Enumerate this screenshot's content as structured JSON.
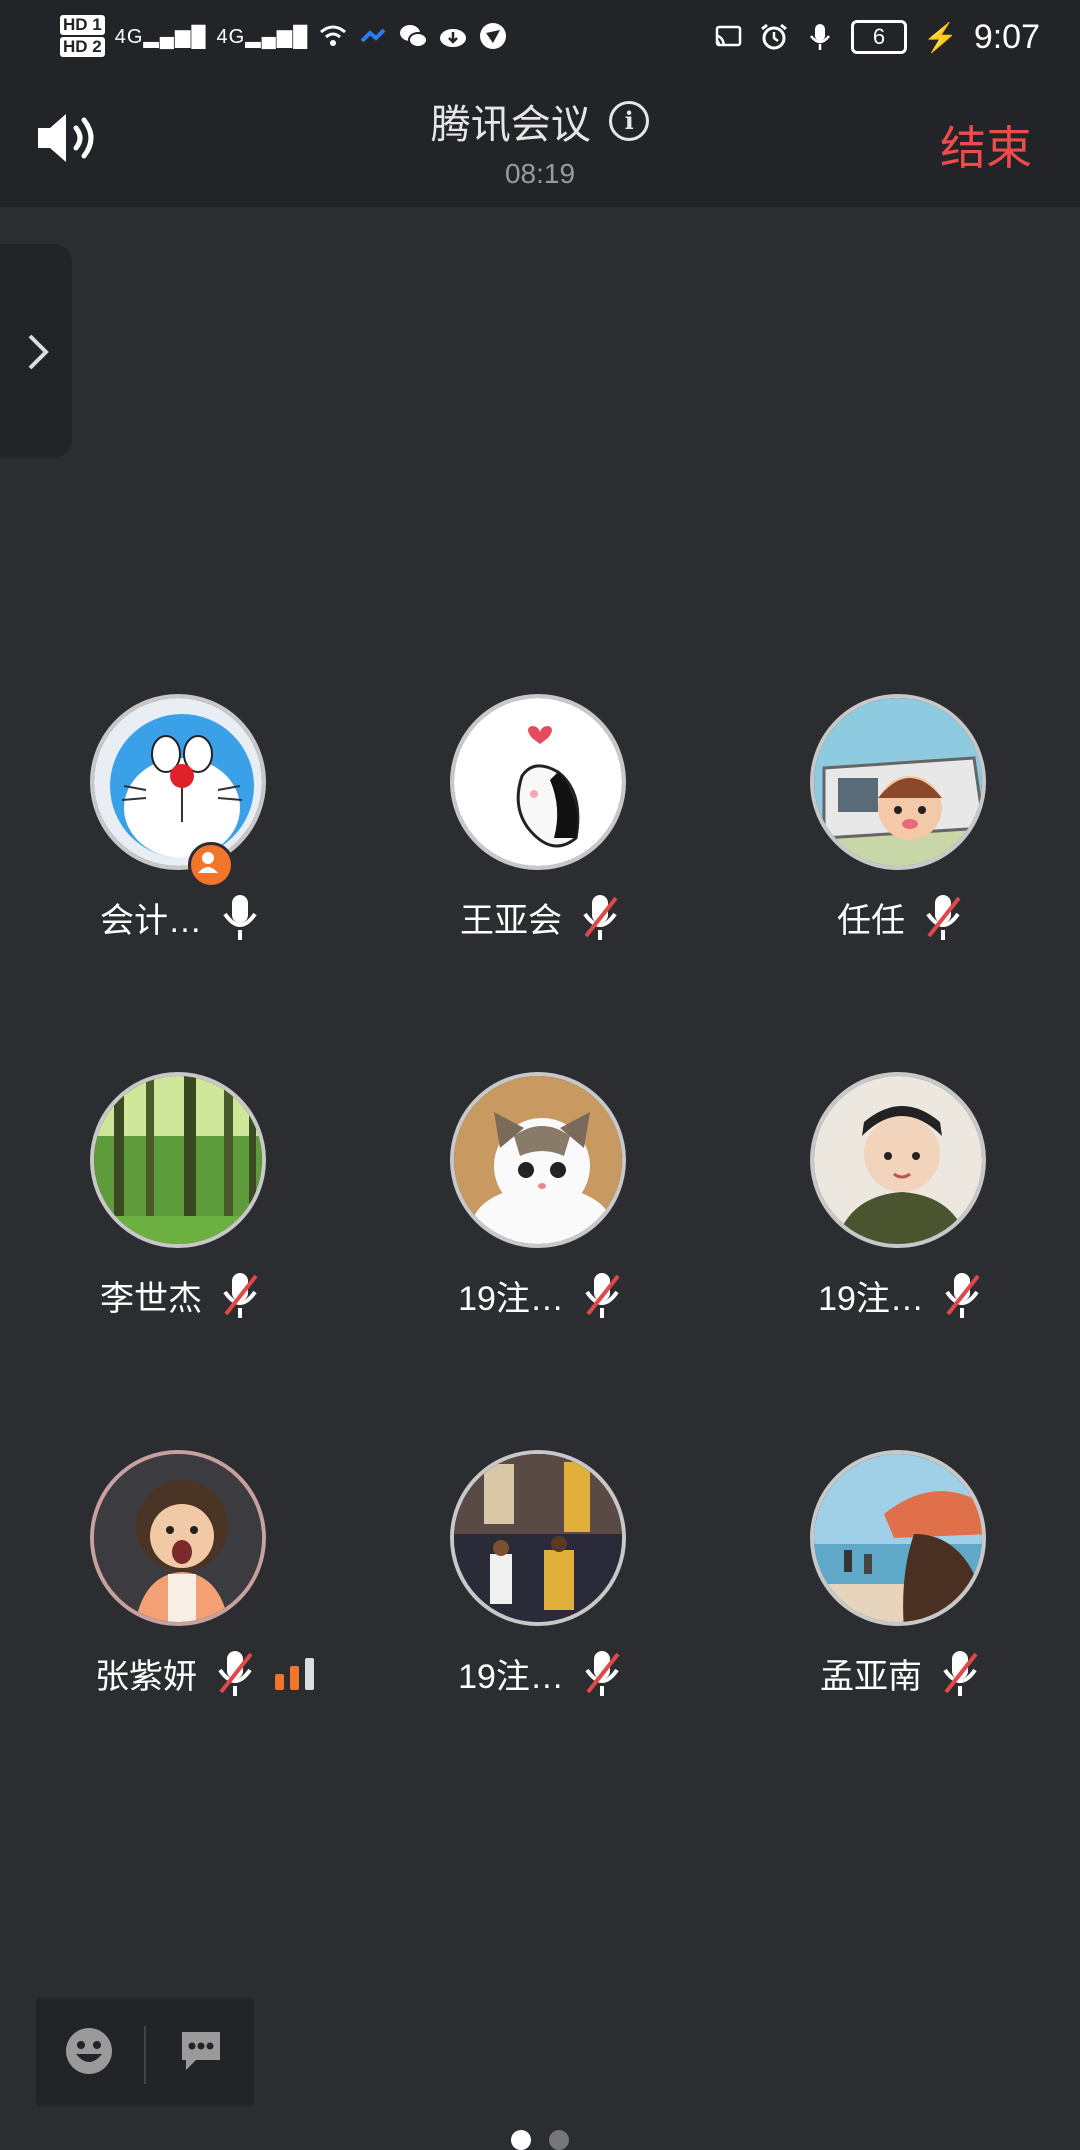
{
  "status_bar": {
    "sim1": "HD 1",
    "sim2": "HD 2",
    "network1": "4G",
    "network2": "4G",
    "battery": "6",
    "time": "9:07"
  },
  "header": {
    "title": "腾讯会议",
    "timer": "08:19",
    "end_label": "结束",
    "info_icon": "i"
  },
  "colors": {
    "background": "#2b2d31",
    "bar": "#232427",
    "end_red": "#ef4b4b",
    "host_orange": "#f3742b",
    "mute_red": "#e0484a"
  },
  "participants": [
    {
      "name": "会计…",
      "mic": "on",
      "host": true
    },
    {
      "name": "王亚会",
      "mic": "muted"
    },
    {
      "name": "任任",
      "mic": "muted"
    },
    {
      "name": "李世杰",
      "mic": "muted"
    },
    {
      "name": "19注…",
      "mic": "muted"
    },
    {
      "name": "19注…",
      "mic": "muted"
    },
    {
      "name": "张紫妍",
      "mic": "muted",
      "signal_level": "2 of 3"
    },
    {
      "name": "19注…",
      "mic": "muted"
    },
    {
      "name": "孟亚南",
      "mic": "muted"
    }
  ],
  "bottom_bar": {
    "emoji_icon": "smile-icon",
    "chat_icon": "chat-bubble-icon"
  },
  "pager": {
    "pages": 2,
    "current": 1
  }
}
